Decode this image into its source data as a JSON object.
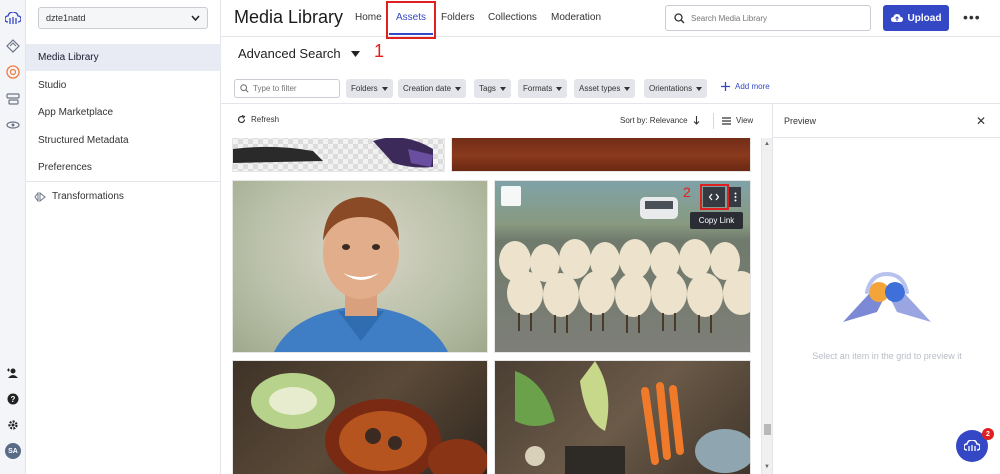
{
  "colors": {
    "accent": "#3448c5",
    "annotation": "#e02020"
  },
  "cloud_selector": {
    "value": "dzte1natd"
  },
  "sidebar": {
    "items": [
      {
        "label": "Media Library"
      },
      {
        "label": "Studio"
      },
      {
        "label": "App Marketplace"
      },
      {
        "label": "Structured Metadata"
      },
      {
        "label": "Preferences"
      },
      {
        "label": "Transformations"
      }
    ]
  },
  "rail_icons": [
    "cloudinary-logo-icon",
    "diamond-icon",
    "media-library-icon",
    "layers-icon",
    "integrations-icon",
    "add-user-icon",
    "help-icon",
    "gear-icon"
  ],
  "avatar": {
    "initials": "SA"
  },
  "header": {
    "title": "Media Library",
    "tabs": [
      {
        "label": "Home"
      },
      {
        "label": "Assets"
      },
      {
        "label": "Folders"
      },
      {
        "label": "Collections"
      },
      {
        "label": "Moderation"
      }
    ],
    "search_placeholder": "Search Media Library",
    "upload_label": "Upload",
    "more_label": "•••"
  },
  "advanced_search": {
    "label": "Advanced Search"
  },
  "annotations": {
    "step1": "1",
    "step2": "2"
  },
  "filters": {
    "placeholder": "Type to filter",
    "chips": [
      {
        "label": "Folders"
      },
      {
        "label": "Creation date"
      },
      {
        "label": "Tags"
      },
      {
        "label": "Formats"
      },
      {
        "label": "Asset types"
      },
      {
        "label": "Orientations"
      }
    ],
    "add_more": "Add more"
  },
  "toolbar": {
    "refresh": "Refresh",
    "sort": "Sort by: Relevance",
    "view": "View"
  },
  "tile_action": {
    "tooltip": "Copy Link"
  },
  "preview": {
    "title": "Preview",
    "hint": "Select an item in the grid to preview it"
  },
  "chat": {
    "badge": "2"
  }
}
